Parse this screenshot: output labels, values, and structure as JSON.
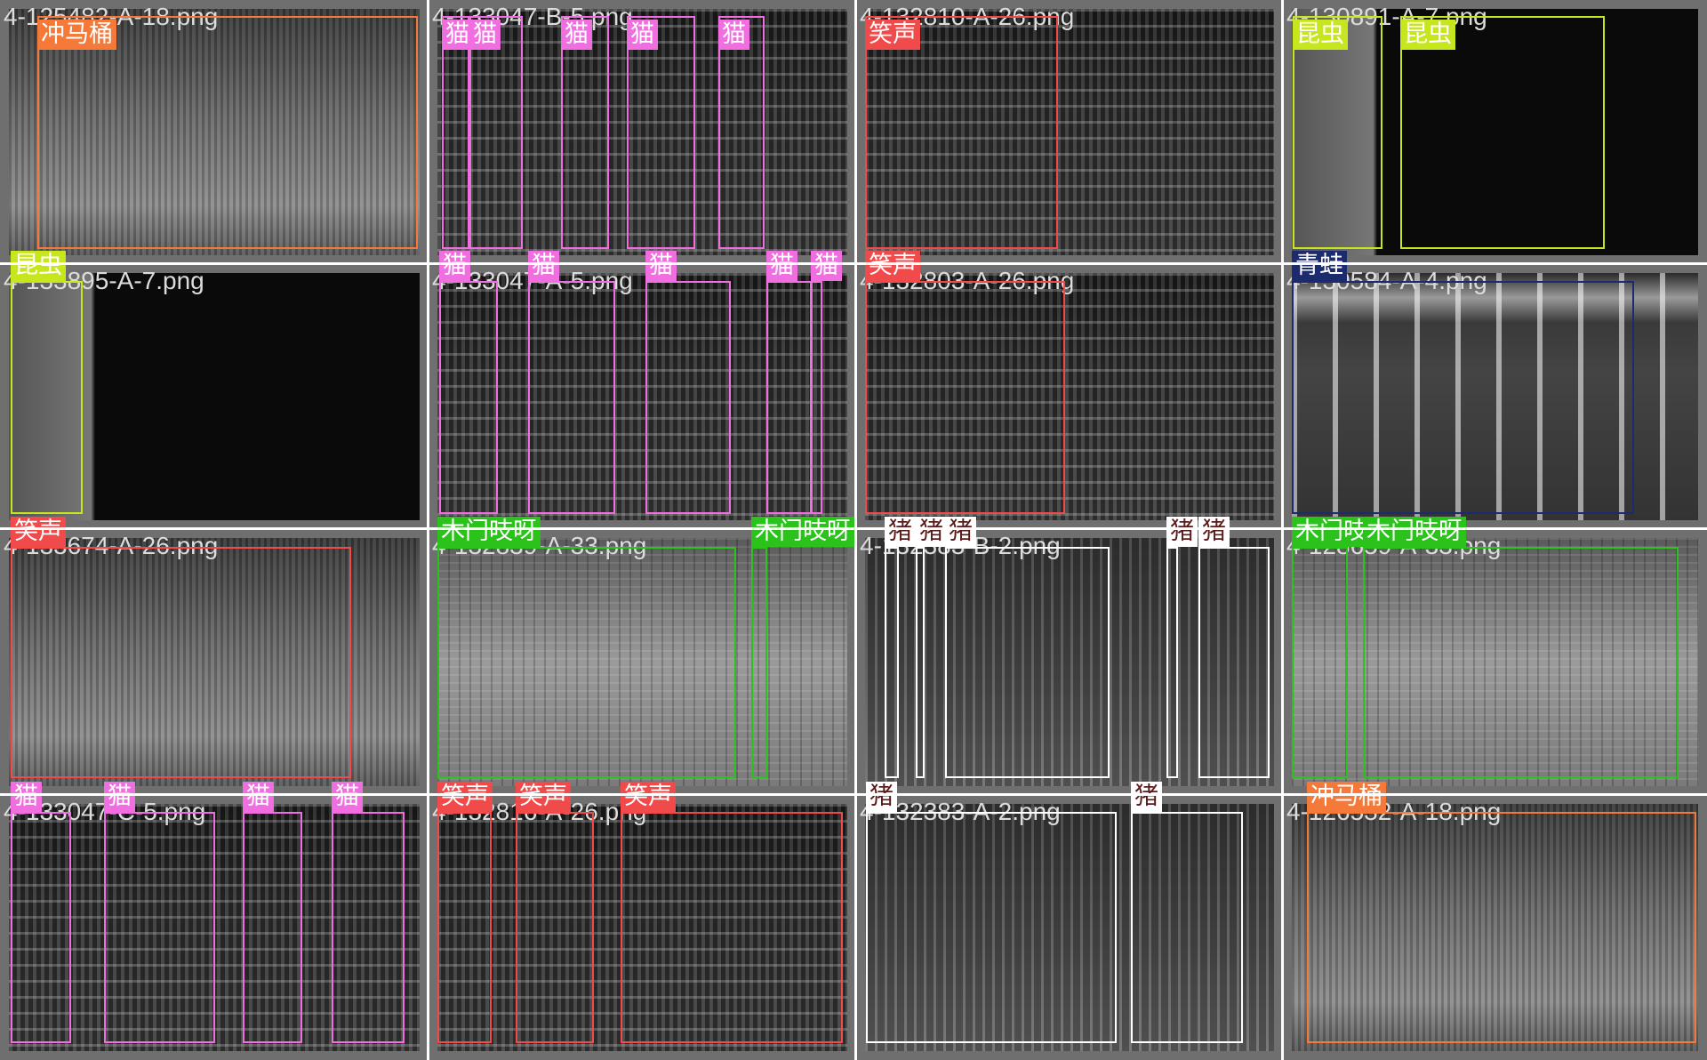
{
  "colors": {
    "冲马桶": "#f57a3a",
    "猫": "#f06ee0",
    "笑声": "#f04a4a",
    "昆虫": "#c8e61e",
    "青蛙": "#1c2a6e",
    "木门吱呀": "#2cc21c",
    "猪": "#ffffff"
  },
  "tiles": [
    {
      "file": "4-125482-A-18.png",
      "style": "A",
      "boxes": [
        {
          "label": "冲马桶"
        }
      ]
    },
    {
      "file": "4-133047-B-5.png",
      "style": "B",
      "boxes": [
        {
          "label": "猫"
        },
        {
          "label": "猫"
        },
        {
          "label": "猫"
        },
        {
          "label": "猫"
        },
        {
          "label": "猫"
        }
      ]
    },
    {
      "file": "4-132810-A-26.png",
      "style": "C",
      "boxes": [
        {
          "label": "笑声"
        }
      ]
    },
    {
      "file": "4-130891-A-7.png",
      "style": "D",
      "boxes": [
        {
          "label": "昆虫"
        },
        {
          "label": "昆虫"
        }
      ]
    },
    {
      "file": "4-133895-A-7.png",
      "style": "E",
      "boxes": [
        {
          "label": "昆虫"
        }
      ]
    },
    {
      "file": "4-133047-A-5.png",
      "style": "B",
      "boxes": [
        {
          "label": "猫"
        },
        {
          "label": "猫"
        },
        {
          "label": "猫"
        },
        {
          "label": "猫"
        },
        {
          "label": "猫"
        }
      ]
    },
    {
      "file": "4-132803-A-26.png",
      "style": "C",
      "boxes": [
        {
          "label": "笑声"
        }
      ]
    },
    {
      "file": "4-130584-A-4.png",
      "style": "F",
      "boxes": [
        {
          "label": "青蛙"
        }
      ]
    },
    {
      "file": "4-133674-A-26.png",
      "style": "G",
      "boxes": [
        {
          "label": "笑声"
        }
      ]
    },
    {
      "file": "4-132839-A-33.png",
      "style": "H",
      "boxes": [
        {
          "label": "木门吱呀"
        },
        {
          "label": "木门吱呀"
        }
      ]
    },
    {
      "file": "4-132383-B-2.png",
      "style": "I",
      "boxes": [
        {
          "label": "猪"
        },
        {
          "label": "猪"
        },
        {
          "label": "猪"
        },
        {
          "label": "猪"
        },
        {
          "label": "猪"
        }
      ]
    },
    {
      "file": "4-128659-A-33.png",
      "style": "J",
      "boxes": [
        {
          "label": "木门吱呀"
        },
        {
          "label": "木门吱呀"
        }
      ]
    },
    {
      "file": "4-133047-C-5.png",
      "style": "B",
      "boxes": [
        {
          "label": "猫"
        },
        {
          "label": "猫"
        },
        {
          "label": "猫"
        },
        {
          "label": "猫"
        }
      ]
    },
    {
      "file": "4-132816-A-26.png",
      "style": "C",
      "boxes": [
        {
          "label": "笑声"
        },
        {
          "label": "笑声"
        },
        {
          "label": "笑声"
        }
      ]
    },
    {
      "file": "4-132383-A-2.png",
      "style": "I",
      "boxes": [
        {
          "label": "猪"
        },
        {
          "label": "猪"
        }
      ]
    },
    {
      "file": "4-126532-A-18.png",
      "style": "A",
      "boxes": [
        {
          "label": "冲马桶"
        }
      ]
    }
  ]
}
